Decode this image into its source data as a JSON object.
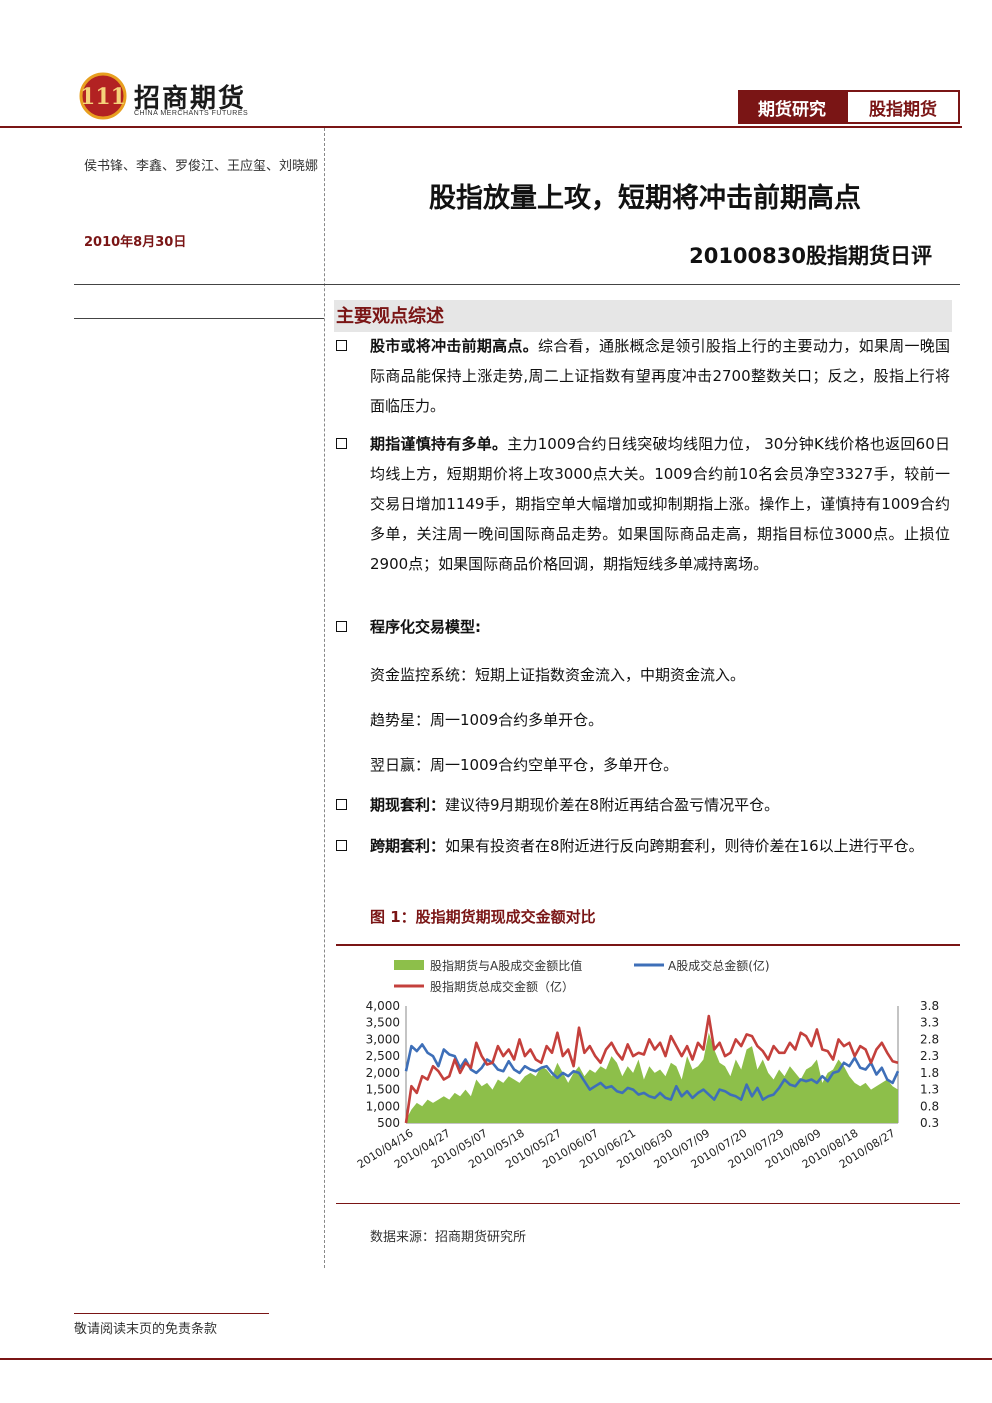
{
  "header": {
    "logo_cn": "招商期货",
    "logo_en": "CHINA MERCHANTS FUTURES",
    "tag_research": "期货研究",
    "tag_index": "股指期货"
  },
  "left": {
    "authors": "侯书锋、李鑫、罗俊江、王应玺、刘晓娜",
    "date": "2010年8月30日"
  },
  "titles": {
    "main": "股指放量上攻，短期将冲击前期高点",
    "sub": "20100830股指期货日评"
  },
  "section": {
    "title": "主要观点综述"
  },
  "paragraphs": {
    "p1_lead": "股市或将冲击前期高点。",
    "p1_text": "综合看，通胀概念是领引股指上行的主要动力，如果周一晚国际商品能保持上涨走势,周二上证指数有望再度冲击2700整数关口；反之，股指上行将面临压力。",
    "p2_lead": "期指谨慎持有多单。",
    "p2_text": "主力1009合约日线突破均线阻力位， 30分钟K线价格也返回60日均线上方，短期期价将上攻3000点大关。1009合约前10名会员净空3327手，较前一交易日增加1149手，期指空单大幅增加或抑制期指上涨。操作上，谨慎持有1009合约多单，关注周一晚间国际商品走势。如果国际商品走高，期指目标位3000点。止损位2900点；如果国际商品价格回调，期指短线多单减持离场。",
    "p3_lead": "程序化交易模型:",
    "line1": "资金监控系统：短期上证指数资金流入，中期资金流入。",
    "line2": "趋势星：周一1009合约多单开仓。",
    "line3": "翌日赢：周一1009合约空单平仓，多单开仓。",
    "p4_lead": "期现套利：",
    "p4_text": "建议待9月期现价差在8附近再结合盈亏情况平仓。",
    "p5_lead": "跨期套利：",
    "p5_text": "如果有投资者在8附近进行反向跨期套利，则待价差在16以上进行平仓。"
  },
  "figure": {
    "title": "图 1：股指期货期现成交金额对比",
    "source": "数据来源：招商期货研究所"
  },
  "footer": {
    "disclaimer": "敬请阅读末页的免责条款"
  },
  "chart_data": {
    "type": "line",
    "title": "",
    "left_axis": {
      "ylim": [
        500,
        4000
      ],
      "ticks": [
        "4,000",
        "3,500",
        "3,000",
        "2,500",
        "2,000",
        "1,500",
        "1,000",
        "500"
      ]
    },
    "right_axis": {
      "ylim": [
        0.3,
        3.8
      ],
      "ticks": [
        "3.8",
        "3.3",
        "2.8",
        "2.3",
        "1.8",
        "1.3",
        "0.8",
        "0.3"
      ]
    },
    "x_tick_labels": [
      "2010/04/16",
      "2010/04/27",
      "2010/05/07",
      "2010/05/18",
      "2010/05/27",
      "2010/06/07",
      "2010/06/21",
      "2010/06/30",
      "2010/07/09",
      "2010/07/20",
      "2010/07/29",
      "2010/08/09",
      "2010/08/18",
      "2010/08/27"
    ],
    "legend_placement": "top",
    "series": [
      {
        "name": "股指期货与A股成交金额比值",
        "kind": "area",
        "axis": "right",
        "color": "#8dbf4a",
        "values": [
          0.4,
          0.7,
          0.9,
          0.8,
          1.0,
          0.9,
          1.0,
          1.1,
          1.0,
          1.2,
          1.1,
          1.3,
          1.1,
          1.6,
          1.4,
          1.5,
          1.3,
          1.6,
          1.5,
          1.7,
          1.6,
          1.5,
          1.7,
          1.8,
          1.7,
          2.0,
          1.9,
          1.7,
          2.1,
          1.8,
          1.5,
          1.8,
          2.0,
          1.7,
          1.9,
          1.8,
          2.0,
          1.9,
          2.3,
          2.1,
          1.7,
          2.0,
          1.8,
          2.2,
          1.6,
          2.0,
          1.8,
          1.9,
          1.7,
          2.1,
          2.0,
          1.6,
          2.3,
          1.9,
          2.0,
          2.2,
          3.0,
          2.5,
          2.1,
          2.0,
          1.7,
          2.2,
          1.9,
          2.5,
          2.6,
          1.9,
          2.2,
          1.8,
          1.6,
          1.9,
          1.7,
          2.0,
          1.8,
          1.6,
          1.9,
          2.0,
          2.2,
          1.5,
          1.8,
          1.9,
          2.2,
          2.0,
          1.7,
          1.5,
          1.4,
          1.5,
          1.3,
          1.4,
          1.5,
          1.6,
          1.4,
          1.3
        ]
      },
      {
        "name": "A股成交总金额(亿)",
        "kind": "line",
        "axis": "left",
        "color": "#3e6fb8",
        "values": [
          2050,
          2800,
          2650,
          2850,
          2600,
          2500,
          2200,
          2700,
          2550,
          2500,
          2150,
          2400,
          2100,
          2000,
          2150,
          2400,
          2300,
          2100,
          2050,
          2350,
          2100,
          2000,
          2200,
          2100,
          2050,
          2150,
          2200,
          2000,
          1850,
          2000,
          1900,
          2050,
          2000,
          1750,
          1500,
          1600,
          1700,
          1550,
          1600,
          1450,
          1400,
          1550,
          1500,
          1350,
          1400,
          1300,
          1250,
          1400,
          1250,
          1200,
          1600,
          1300,
          1450,
          1250,
          1400,
          1500,
          1350,
          1200,
          1500,
          1450,
          1350,
          1300,
          1200,
          1650,
          1300,
          1550,
          1200,
          1300,
          1350,
          1550,
          1800,
          1650,
          1600,
          1800,
          1750,
          1800,
          1700,
          1900,
          1750,
          2000,
          2050,
          2300,
          2200,
          2450,
          2150,
          2100,
          2300,
          1950,
          2150,
          1800,
          1700,
          2050
        ]
      },
      {
        "name": "股指期货总成交金额（亿）",
        "kind": "line",
        "axis": "left",
        "color": "#c4403c",
        "values": [
          500,
          1600,
          1400,
          1900,
          1800,
          2200,
          2050,
          1800,
          1900,
          2400,
          2000,
          2300,
          2150,
          2900,
          2500,
          2250,
          2300,
          2800,
          2500,
          2700,
          2400,
          3000,
          2500,
          2700,
          2400,
          2300,
          2800,
          2600,
          3200,
          2500,
          2700,
          2200,
          3350,
          2600,
          2800,
          2500,
          2300,
          2700,
          2900,
          2600,
          2400,
          2850,
          2500,
          2600,
          2550,
          3000,
          2700,
          2900,
          2500,
          3100,
          2800,
          2500,
          2800,
          2400,
          2900,
          2700,
          3700,
          2700,
          2900,
          2500,
          2600,
          3000,
          2800,
          3150,
          3100,
          2800,
          2650,
          2400,
          2800,
          2600,
          2600,
          2900,
          2700,
          3200,
          3100,
          2800,
          3300,
          2700,
          2650,
          2400,
          3000,
          2800,
          2900,
          2500,
          2800,
          2700,
          2300,
          2700,
          2900,
          2600,
          2350,
          2300
        ]
      }
    ]
  }
}
